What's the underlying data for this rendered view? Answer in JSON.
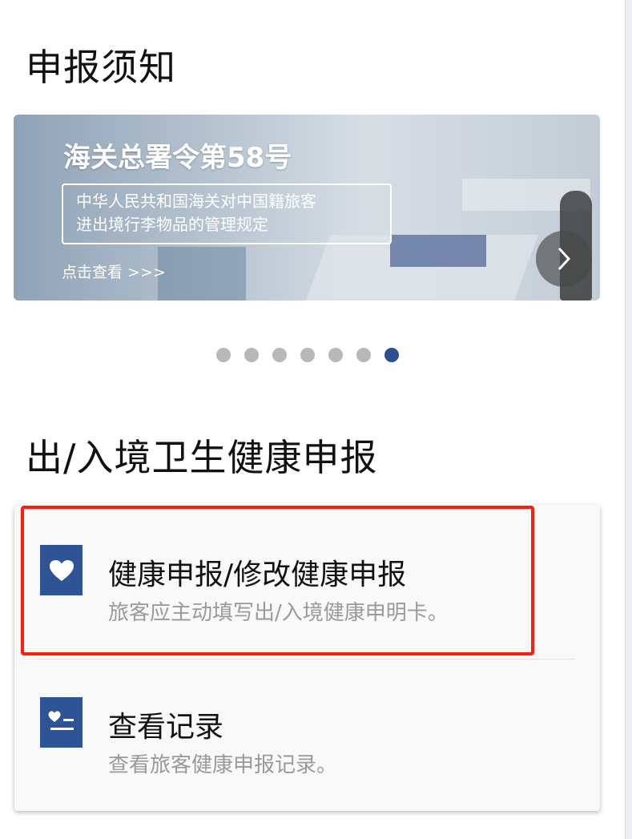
{
  "notice_section": {
    "title": "申报须知"
  },
  "banner": {
    "heading": "海关总署令第58号",
    "box_line1": "中华人民共和国海关对中国籍旅客",
    "box_line2": "进出境行李物品的管理规定",
    "cta": "点击查看 >>>"
  },
  "carousel": {
    "total": 7,
    "active_index": 6,
    "active_color": "#2c4f8f",
    "inactive_color": "#b8b8b8"
  },
  "health_section": {
    "title": "出/入境卫生健康申报"
  },
  "menu": {
    "items": [
      {
        "icon": "heart-icon",
        "title": "健康申报/修改健康申报",
        "desc": "旅客应主动填写出/入境健康申明卡。"
      },
      {
        "icon": "record-list-icon",
        "title": "查看记录",
        "desc": "查看旅客健康申报记录。"
      }
    ]
  },
  "colors": {
    "icon_bg": "#2f5496",
    "highlight": "#ff1d12"
  }
}
